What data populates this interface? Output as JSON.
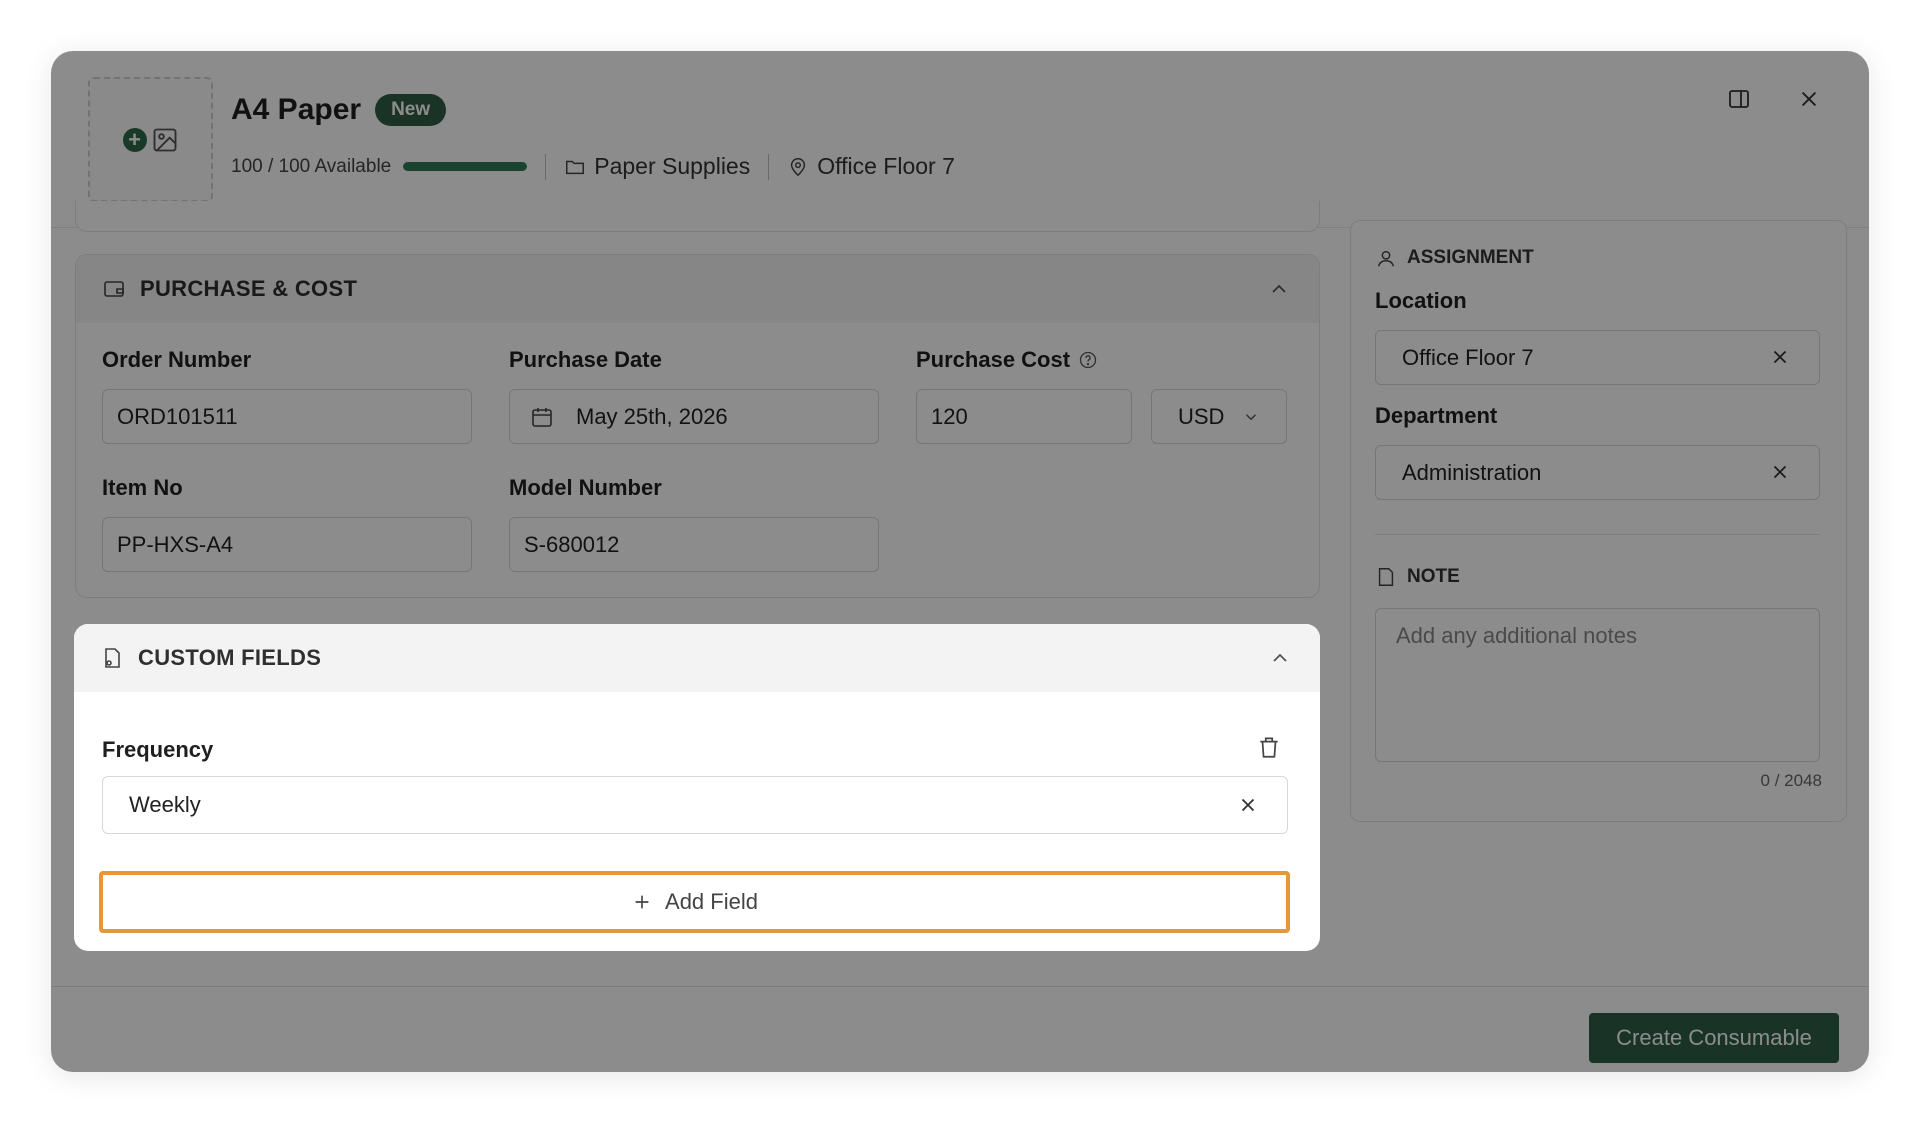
{
  "item": {
    "title": "A4 Paper",
    "badge": "New",
    "availability": "100 / 100 Available",
    "availability_fraction": 1.0,
    "category": "Paper Supplies",
    "location": "Office Floor 7"
  },
  "purchase": {
    "heading": "PURCHASE & COST",
    "order_number_label": "Order Number",
    "order_number": "ORD101511",
    "purchase_date_label": "Purchase Date",
    "purchase_date": "May 25th, 2026",
    "purchase_cost_label": "Purchase Cost",
    "purchase_cost": "120",
    "currency": "USD",
    "item_no_label": "Item No",
    "item_no": "PP-HXS-A4",
    "model_number_label": "Model Number",
    "model_number": "S-680012"
  },
  "custom_fields": {
    "heading": "CUSTOM FIELDS",
    "field_label": "Frequency",
    "field_value": "Weekly",
    "add_label": "Add Field"
  },
  "assignment": {
    "heading": "ASSIGNMENT",
    "location_label": "Location",
    "location_value": "Office Floor 7",
    "department_label": "Department",
    "department_value": "Administration"
  },
  "note": {
    "heading": "NOTE",
    "placeholder": "Add any additional notes",
    "counter": "0 / 2048"
  },
  "footer": {
    "create_label": "Create Consumable"
  },
  "colors": {
    "brand": "#2e5e46",
    "focus_outline": "#e8963a"
  }
}
